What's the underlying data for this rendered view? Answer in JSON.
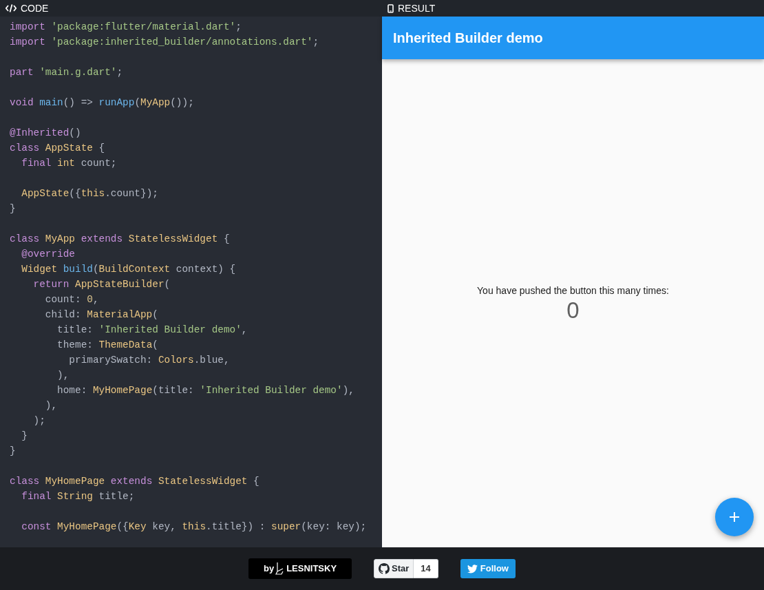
{
  "code_panel": {
    "header": "CODE",
    "lines": [
      {
        "tokens": [
          {
            "kind": "kw",
            "text": "import"
          },
          {
            "kind": "str",
            "text": " 'package:flutter/material.dart'"
          },
          {
            "kind": "p",
            "text": ";"
          }
        ]
      },
      {
        "tokens": [
          {
            "kind": "kw",
            "text": "import"
          },
          {
            "kind": "str",
            "text": " 'package:inherited_builder/annotations.dart'"
          },
          {
            "kind": "p",
            "text": ";"
          }
        ]
      },
      {
        "space_before": true,
        "tokens": [
          {
            "kind": "kw",
            "text": "part"
          },
          {
            "kind": "str",
            "text": " 'main.g.dart'"
          },
          {
            "kind": "p",
            "text": ";"
          }
        ]
      },
      {
        "space_before": true,
        "tokens": [
          {
            "kind": "kw",
            "text": "void"
          },
          {
            "kind": "fn",
            "text": " main"
          },
          {
            "kind": "p",
            "text": "() => "
          },
          {
            "kind": "fn",
            "text": "runApp"
          },
          {
            "kind": "p",
            "text": "("
          },
          {
            "kind": "type",
            "text": "MyApp"
          },
          {
            "kind": "p",
            "text": "());"
          }
        ]
      },
      {
        "space_before": true,
        "tokens": [
          {
            "kind": "kw",
            "text": "@Inherited"
          },
          {
            "kind": "p",
            "text": "()"
          }
        ]
      },
      {
        "tokens": [
          {
            "kind": "kw",
            "text": "class"
          },
          {
            "kind": "type",
            "text": " AppState"
          },
          {
            "kind": "p",
            "text": " {"
          }
        ]
      },
      {
        "tokens": [
          {
            "kind": "kw",
            "text": "  final"
          },
          {
            "kind": "type",
            "text": " int"
          },
          {
            "kind": "p",
            "text": " count;"
          }
        ]
      },
      {
        "space_before": true,
        "tokens": [
          {
            "kind": "type",
            "text": "  AppState"
          },
          {
            "kind": "p",
            "text": "({"
          },
          {
            "kind": "type",
            "text": "this"
          },
          {
            "kind": "p",
            "text": ".count});"
          }
        ]
      },
      {
        "tokens": [
          {
            "kind": "p",
            "text": "}"
          }
        ]
      },
      {
        "space_before": true,
        "tokens": [
          {
            "kind": "kw",
            "text": "class"
          },
          {
            "kind": "type",
            "text": " MyApp"
          },
          {
            "kind": "kw",
            "text": " extends"
          },
          {
            "kind": "type",
            "text": " StatelessWidget"
          },
          {
            "kind": "p",
            "text": " {"
          }
        ]
      },
      {
        "tokens": [
          {
            "kind": "kw",
            "text": "  @override"
          }
        ]
      },
      {
        "tokens": [
          {
            "kind": "type",
            "text": "  Widget"
          },
          {
            "kind": "fn",
            "text": " build"
          },
          {
            "kind": "p",
            "text": "("
          },
          {
            "kind": "type",
            "text": "BuildContext"
          },
          {
            "kind": "p",
            "text": " context) {"
          }
        ]
      },
      {
        "tokens": [
          {
            "kind": "kw",
            "text": "    return"
          },
          {
            "kind": "type",
            "text": " AppStateBuilder"
          },
          {
            "kind": "p",
            "text": "("
          }
        ]
      },
      {
        "tokens": [
          {
            "kind": "p",
            "text": "      count: "
          },
          {
            "kind": "num",
            "text": "0"
          },
          {
            "kind": "p",
            "text": ","
          }
        ]
      },
      {
        "tokens": [
          {
            "kind": "p",
            "text": "      child: "
          },
          {
            "kind": "type",
            "text": "MaterialApp"
          },
          {
            "kind": "p",
            "text": "("
          }
        ]
      },
      {
        "tokens": [
          {
            "kind": "p",
            "text": "        title: "
          },
          {
            "kind": "str",
            "text": "'Inherited Builder demo'"
          },
          {
            "kind": "p",
            "text": ","
          }
        ]
      },
      {
        "tokens": [
          {
            "kind": "p",
            "text": "        theme: "
          },
          {
            "kind": "type",
            "text": "ThemeData"
          },
          {
            "kind": "p",
            "text": "("
          }
        ]
      },
      {
        "tokens": [
          {
            "kind": "p",
            "text": "          primarySwatch: "
          },
          {
            "kind": "type",
            "text": "Colors"
          },
          {
            "kind": "p",
            "text": ".blue,"
          }
        ]
      },
      {
        "tokens": [
          {
            "kind": "p",
            "text": "        ),"
          }
        ]
      },
      {
        "tokens": [
          {
            "kind": "p",
            "text": "        home: "
          },
          {
            "kind": "type",
            "text": "MyHomePage"
          },
          {
            "kind": "p",
            "text": "(title: "
          },
          {
            "kind": "str",
            "text": "'Inherited Builder demo'"
          },
          {
            "kind": "p",
            "text": "),"
          }
        ]
      },
      {
        "tokens": [
          {
            "kind": "p",
            "text": "      ),"
          }
        ]
      },
      {
        "tokens": [
          {
            "kind": "p",
            "text": "    );"
          }
        ]
      },
      {
        "tokens": [
          {
            "kind": "p",
            "text": "  }"
          }
        ]
      },
      {
        "tokens": [
          {
            "kind": "p",
            "text": "}"
          }
        ]
      },
      {
        "space_before": true,
        "tokens": [
          {
            "kind": "kw",
            "text": "class"
          },
          {
            "kind": "type",
            "text": " MyHomePage"
          },
          {
            "kind": "kw",
            "text": " extends"
          },
          {
            "kind": "type",
            "text": " StatelessWidget"
          },
          {
            "kind": "p",
            "text": " {"
          }
        ]
      },
      {
        "tokens": [
          {
            "kind": "kw",
            "text": "  final"
          },
          {
            "kind": "type",
            "text": " String"
          },
          {
            "kind": "p",
            "text": " title;"
          }
        ]
      },
      {
        "space_before": true,
        "tokens": [
          {
            "kind": "kw",
            "text": "  const"
          },
          {
            "kind": "type",
            "text": " MyHomePage"
          },
          {
            "kind": "p",
            "text": "({"
          },
          {
            "kind": "type",
            "text": "Key"
          },
          {
            "kind": "p",
            "text": " key, "
          },
          {
            "kind": "type",
            "text": "this"
          },
          {
            "kind": "p",
            "text": ".title}) : "
          },
          {
            "kind": "type",
            "text": "super"
          },
          {
            "kind": "p",
            "text": "(key: key);"
          }
        ]
      }
    ]
  },
  "result_panel": {
    "header": "RESULT",
    "app_bar_title": "Inherited Builder demo",
    "message": "You have pushed the button this many times:",
    "counter": "0"
  },
  "footer": {
    "author": {
      "prefix": "by",
      "name": "LESNITSKY"
    },
    "github": {
      "label": "Star",
      "count": "14"
    },
    "twitter": {
      "label": "Follow"
    }
  }
}
